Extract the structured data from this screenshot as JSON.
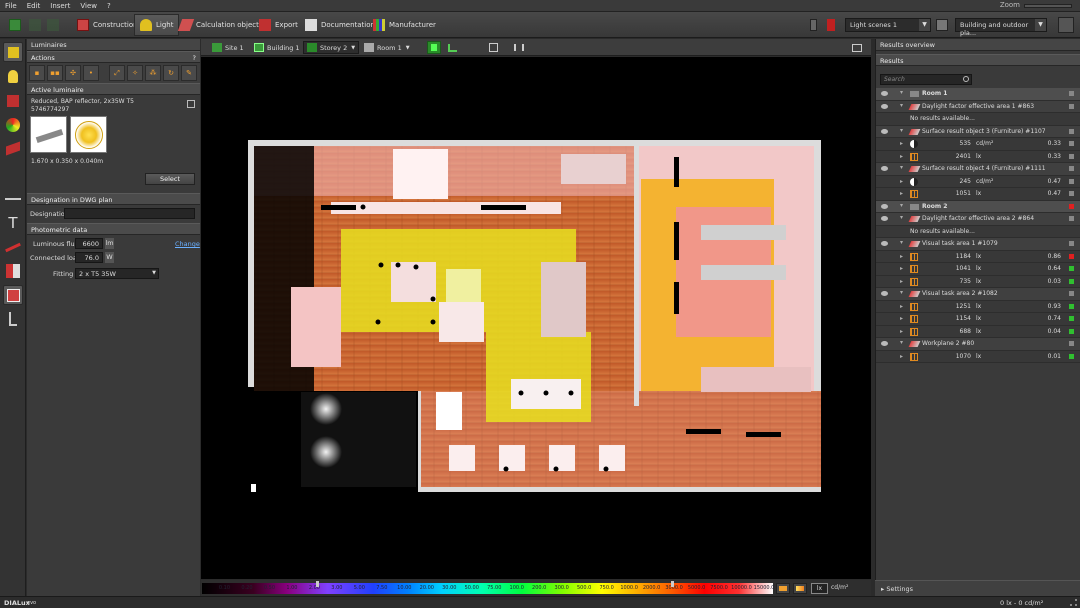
{
  "menu": [
    "File",
    "Edit",
    "Insert",
    "View",
    "?"
  ],
  "zoom_label": "Zoom",
  "toolbar": {
    "construction": "Construction",
    "light": "Light",
    "calc_objects": "Calculation objects",
    "export": "Export",
    "documentation": "Documentation",
    "manufacturer": "Manufacturer",
    "light_scenes": "Light scenes 1",
    "building_outdoor": "Building and outdoor pla..."
  },
  "left": {
    "luminaires": "Luminaires",
    "actions": "Actions",
    "help": "?",
    "active_luminaire": "Active luminaire",
    "lum_name": "Reduced, BAP reflector, 2x35W T5",
    "lum_code": "5746774297",
    "lum_dims": "1.670 x 0.350 x 0.040m",
    "select": "Select",
    "designation_dwg": "Designation in DWG plan",
    "designation": "Designation",
    "photometric": "Photometric data",
    "flux_label": "Luminous flux",
    "flux_value": "6600",
    "flux_unit": "lm",
    "change": "Change",
    "load_label": "Connected load",
    "load_value": "76.0",
    "load_unit": "W",
    "fitting_label": "Fitting",
    "fitting_value": "2 x T5 35W"
  },
  "viewbar": {
    "site": "Site 1",
    "building": "Building 1",
    "storey": "Storey 2",
    "room": "Room 1"
  },
  "colorbar": {
    "ticks": [
      "0.10",
      "0.20",
      "0.50",
      "1.00",
      "2.00",
      "3.00",
      "5.00",
      "7.50",
      "10.00",
      "20.00",
      "30.00",
      "50.00",
      "75.00",
      "100.0",
      "200.0",
      "300.0",
      "500.0",
      "750.0",
      "1000.0",
      "2000.0",
      "3000.0",
      "5000.0",
      "7500.0",
      "10000.0",
      "15000.0"
    ],
    "lx": "lx",
    "cdm": "cd/m²"
  },
  "right": {
    "overview": "Results overview",
    "results": "Results",
    "search_placeholder": "Search",
    "rows": [
      {
        "kind": "room",
        "text": "Room 1"
      },
      {
        "kind": "obj",
        "text": "Daylight factor effective area 1  #863"
      },
      {
        "kind": "note",
        "text": "No results available..."
      },
      {
        "kind": "obj",
        "text": "Surface result object 3 (Furniture)  #1107"
      },
      {
        "kind": "val",
        "icon": "half",
        "num": "535",
        "unit": "cd/m²",
        "ratio": "0.33",
        "status": "#888888"
      },
      {
        "kind": "val",
        "icon": "grid",
        "num": "2401",
        "unit": "lx",
        "ratio": "0.33",
        "status": "#888888"
      },
      {
        "kind": "obj",
        "text": "Surface result object 4 (Furniture)  #1111"
      },
      {
        "kind": "val",
        "icon": "half",
        "num": "245",
        "unit": "cd/m²",
        "ratio": "0.47",
        "status": "#888888"
      },
      {
        "kind": "val",
        "icon": "grid",
        "num": "1051",
        "unit": "lx",
        "ratio": "0.47",
        "status": "#888888"
      },
      {
        "kind": "room",
        "text": "Room 2"
      },
      {
        "kind": "obj",
        "text": "Daylight factor effective area 2  #864"
      },
      {
        "kind": "note",
        "text": "No results available..."
      },
      {
        "kind": "obj",
        "text": "Visual task area 1  #1079"
      },
      {
        "kind": "val",
        "icon": "grid",
        "num": "1184",
        "unit": "lx",
        "ratio": "0.86",
        "status": "#e02020"
      },
      {
        "kind": "val",
        "icon": "grid",
        "num": "1041",
        "unit": "lx",
        "ratio": "0.64",
        "status": "#30c030"
      },
      {
        "kind": "val",
        "icon": "grid",
        "num": "735",
        "unit": "lx",
        "ratio": "0.03",
        "status": "#30c030"
      },
      {
        "kind": "obj",
        "text": "Visual task area 2  #1082"
      },
      {
        "kind": "val",
        "icon": "grid",
        "num": "1251",
        "unit": "lx",
        "ratio": "0.93",
        "status": "#30c030"
      },
      {
        "kind": "val",
        "icon": "grid",
        "num": "1154",
        "unit": "lx",
        "ratio": "0.74",
        "status": "#30c030"
      },
      {
        "kind": "val",
        "icon": "grid",
        "num": "688",
        "unit": "lx",
        "ratio": "0.04",
        "status": "#30c030"
      },
      {
        "kind": "obj",
        "text": "Workplane 2  #80"
      },
      {
        "kind": "val",
        "icon": "grid",
        "num": "1070",
        "unit": "lx",
        "ratio": "0.01",
        "status": "#30c030"
      }
    ],
    "settings": "Settings"
  },
  "status": {
    "app_name": "DIALux",
    "app_suffix": "evo",
    "readout": "0 lx - 0 cd/m²"
  },
  "colors": {
    "accent": "#f0a030",
    "ok": "#30c030",
    "bad": "#e02020"
  }
}
